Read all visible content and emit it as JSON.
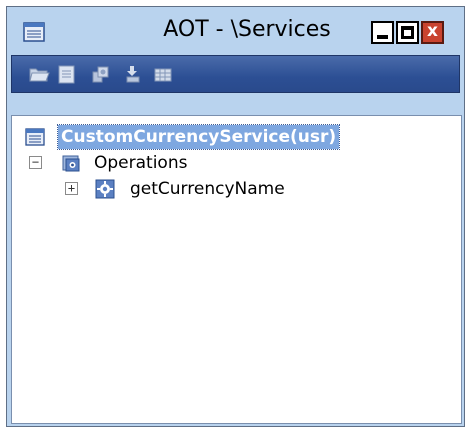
{
  "window": {
    "title": "AOT - \\Services",
    "controls": {
      "minimize": "minimize-icon",
      "maximize": "maximize-icon",
      "close_glyph": "x"
    }
  },
  "toolbar": {
    "buttons": [
      {
        "name": "open-folder-icon"
      },
      {
        "name": "properties-icon"
      },
      {
        "name": "compile-icon"
      },
      {
        "name": "import-export-icon"
      },
      {
        "name": "table-icon"
      }
    ]
  },
  "tree": {
    "root": {
      "label": "CustomCurrencyService(usr)",
      "icon": "service-icon",
      "selected": true
    },
    "children": [
      {
        "label": "Operations",
        "icon": "operations-folder-icon",
        "expander": "−",
        "children": [
          {
            "label": "getCurrencyName",
            "icon": "method-icon",
            "expander": "+"
          }
        ]
      }
    ]
  },
  "colors": {
    "window_bg": "#b9d3ee",
    "toolbar_bg": "#2c4f94",
    "selection_bg": "#7ea7e0",
    "close_button": "#c9432f"
  }
}
